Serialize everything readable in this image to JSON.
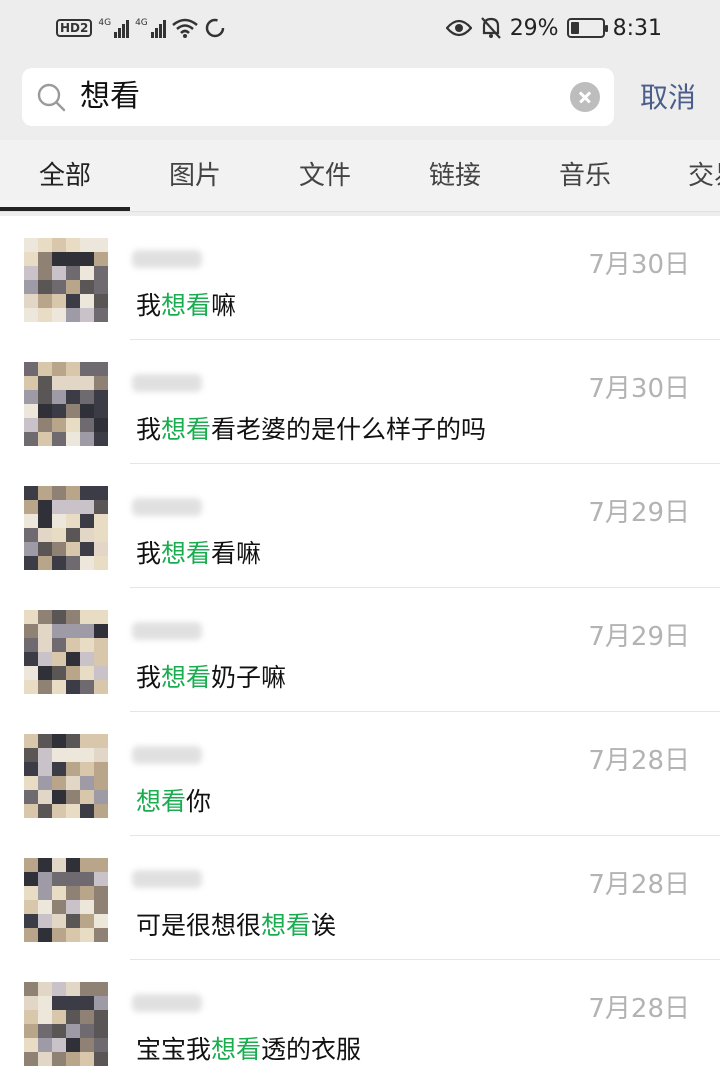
{
  "status_bar": {
    "hd": "HD",
    "hd_num": "2",
    "sig1_label": "4G",
    "sig2_label": "4G",
    "battery": "29%",
    "battery_level": 0.29,
    "time": "8:31"
  },
  "search": {
    "query": "想看",
    "cancel_label": "取消"
  },
  "tabs": [
    {
      "label": "全部"
    },
    {
      "label": "图片"
    },
    {
      "label": "文件"
    },
    {
      "label": "链接"
    },
    {
      "label": "音乐"
    },
    {
      "label": "交易"
    }
  ],
  "results": [
    {
      "date": "7月30日",
      "pre": "我",
      "hl": "想看",
      "post": "嘛"
    },
    {
      "date": "7月30日",
      "pre": "我",
      "hl": "想看",
      "post": "看老婆的是什么样子的吗"
    },
    {
      "date": "7月29日",
      "pre": "我",
      "hl": "想看",
      "post": "看嘛"
    },
    {
      "date": "7月29日",
      "pre": "我",
      "hl": "想看",
      "post": "奶子嘛"
    },
    {
      "date": "7月28日",
      "pre": "",
      "hl": "想看",
      "post": "你"
    },
    {
      "date": "7月28日",
      "pre": "可是很想很",
      "hl": "想看",
      "post": "诶"
    },
    {
      "date": "7月28日",
      "pre": "宝宝我",
      "hl": "想看",
      "post": "透的衣服"
    }
  ],
  "colors": {
    "highlight": "#1aad4f",
    "cancel": "#4a5d8b",
    "date": "#b3b3b3"
  }
}
